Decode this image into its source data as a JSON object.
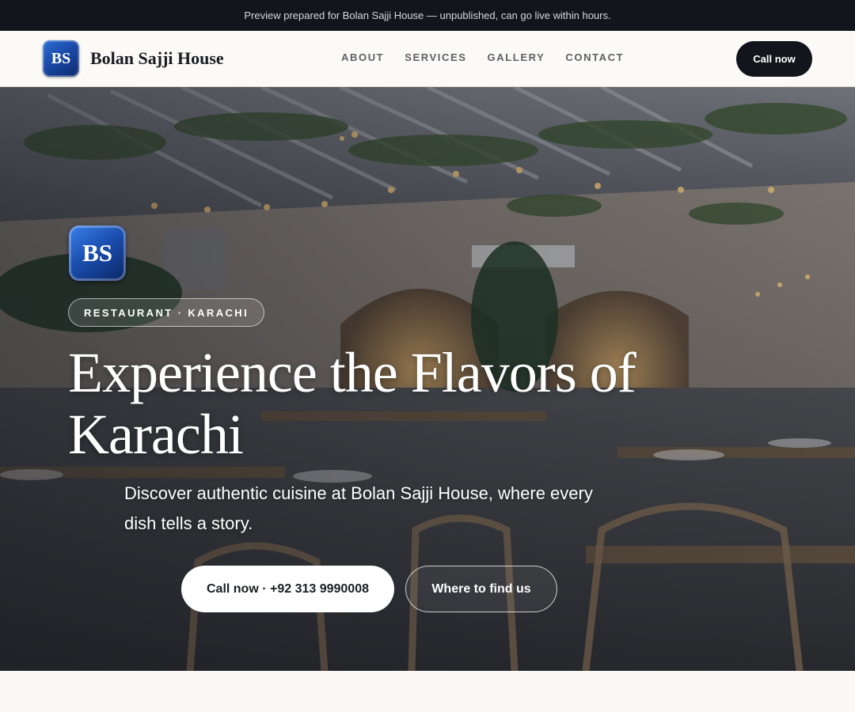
{
  "preview_bar": {
    "text": "Preview prepared for Bolan Sajji House — unpublished, can go live within hours."
  },
  "header": {
    "logo_initials": "BS",
    "brand_name": "Bolan Sajji House",
    "nav": [
      "ABOUT",
      "SERVICES",
      "GALLERY",
      "CONTACT"
    ],
    "call_button": "Call now"
  },
  "hero": {
    "logo_initials": "BS",
    "tag": "RESTAURANT · KARACHI",
    "title": "Experience the Flavors of Karachi",
    "subtitle": "Discover authentic cuisine at Bolan Sajji House, where every dish tells a story.",
    "primary_button": "Call now · +92 313 9990008",
    "secondary_button": "Where to find us"
  },
  "colors": {
    "dark": "#12151b",
    "brand_blue": "#1a4aa8",
    "page_bg": "#faf9f6"
  }
}
